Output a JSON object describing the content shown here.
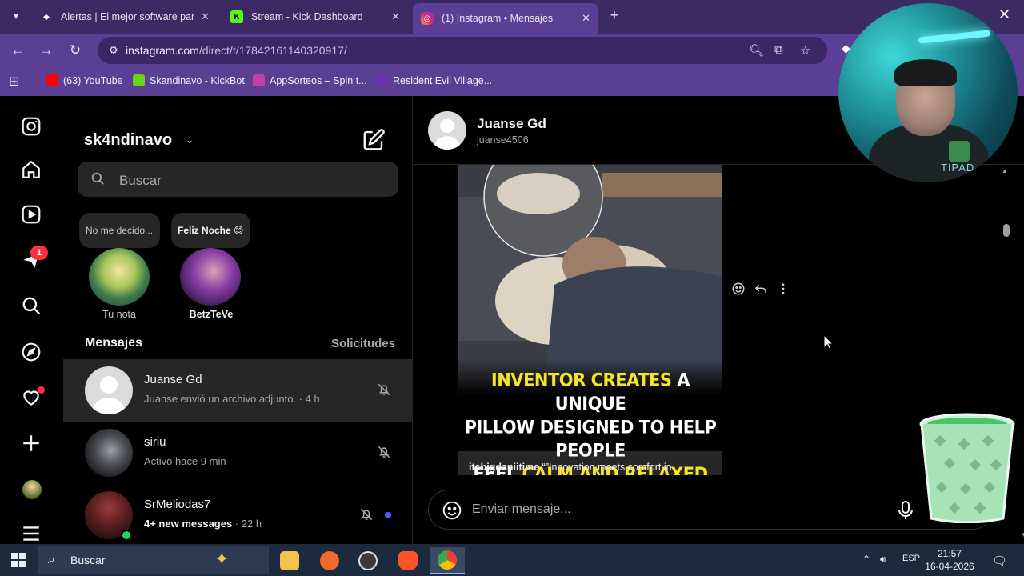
{
  "browser": {
    "tabs": [
      {
        "title": "Alertas | El mejor software para",
        "active": false
      },
      {
        "title": "Stream - Kick Dashboard",
        "active": false
      },
      {
        "title": "(1) Instagram • Mensajes",
        "active": true
      }
    ],
    "url_host": "instagram.com",
    "url_path": "/direct/t/17842161140320917/",
    "bookmarks": [
      {
        "label": "(63) YouTube",
        "color": "#ff0000"
      },
      {
        "label": "Skandinavo - KickBot",
        "color": "#6ad31a"
      },
      {
        "label": "AppSorteos – Spin t...",
        "color": "#c03fa8"
      },
      {
        "label": "Resident Evil Village...",
        "color": "#6b2fb5"
      }
    ]
  },
  "sidebar": {
    "notification_count": "1"
  },
  "inbox": {
    "account": "sk4ndinavo",
    "search_placeholder": "Buscar",
    "notes": [
      {
        "text": "No me decido...",
        "name": "Tu nota"
      },
      {
        "text": "Feliz Noche 😊",
        "name": "BetzTeVe"
      }
    ],
    "section_title": "Mensajes",
    "requests_label": "Solicitudes",
    "threads": [
      {
        "name": "Juanse Gd",
        "subtitle": "Juanse envió un archivo adjunto. · 4 h",
        "muted": true,
        "unread": false,
        "selected": true
      },
      {
        "name": "siriu",
        "subtitle": "Activo hace 9 min",
        "muted": true,
        "unread": false,
        "selected": false
      },
      {
        "name": "SrMeliodas7",
        "subtitle_bold": "4+ new messages",
        "subtitle_rest": " · 22 h",
        "muted": true,
        "unread": true,
        "selected": false
      }
    ]
  },
  "conversation": {
    "name": "Juanse Gd",
    "username": "juanse4506",
    "post": {
      "headline_1a": "Inventor creates",
      "headline_1b": " a unique",
      "headline_2": "pillow designed to help people",
      "headline_3a": "feel ",
      "headline_3b": "calm and relaxed",
      "author": "itsbigdaniitime",
      "caption": " “”Innovation meets comfort in"
    },
    "composer_placeholder": "Enviar mensaje..."
  },
  "overlay": {
    "cam_text": "TIPAD"
  },
  "taskbar": {
    "search_placeholder": "Buscar",
    "lang": "ESP",
    "time": "21:57",
    "date": "16-04-2026"
  },
  "colors": {
    "browser_frame": "#5a3f94",
    "instagram_bg": "#000000",
    "headline_accent": "#f3e52a",
    "notification_red": "#ff3040"
  }
}
